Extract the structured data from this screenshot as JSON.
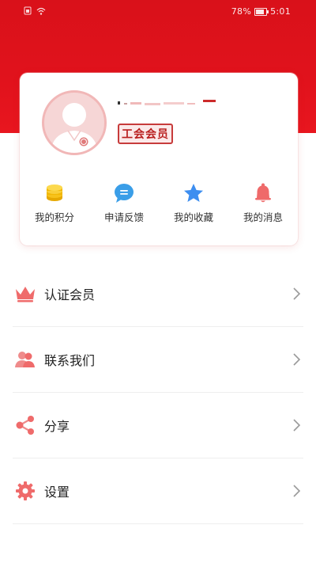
{
  "status_bar": {
    "battery": "78%",
    "time": "5:01"
  },
  "profile": {
    "badge": "工会会员"
  },
  "shortcuts": [
    {
      "label": "我的积分",
      "icon": "coins-icon",
      "color": "#f2b705"
    },
    {
      "label": "申请反馈",
      "icon": "chat-bubble-icon",
      "color": "#3a9ee8"
    },
    {
      "label": "我的收藏",
      "icon": "star-icon",
      "color": "#3d8ef0"
    },
    {
      "label": "我的消息",
      "icon": "bell-icon",
      "color": "#ef6a6a"
    }
  ],
  "menu": [
    {
      "label": "认证会员",
      "icon": "crown-icon"
    },
    {
      "label": "联系我们",
      "icon": "contacts-icon"
    },
    {
      "label": "分享",
      "icon": "share-icon"
    },
    {
      "label": "设置",
      "icon": "gear-icon"
    }
  ],
  "colors": {
    "header_red": "#e1121c",
    "icon_red": "#ef6b6b",
    "badge_border": "#c73b3b"
  }
}
